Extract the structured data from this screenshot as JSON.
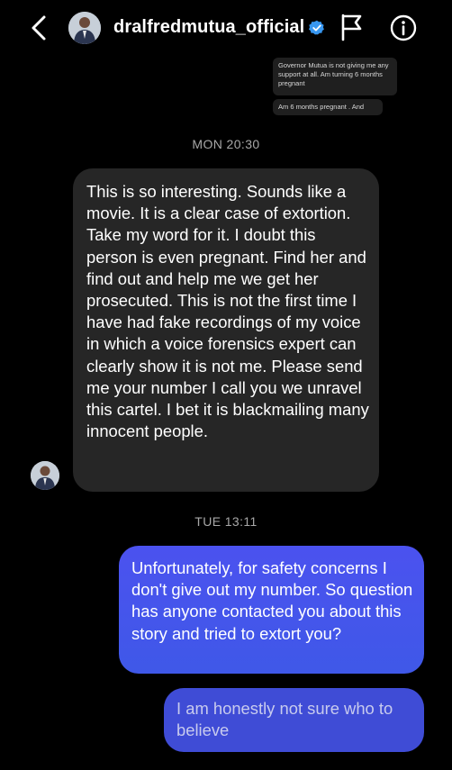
{
  "header": {
    "back_icon": "chevron-left-icon",
    "username": "dralfredmutua_official",
    "verified_icon": "verified-badge-icon",
    "report_icon": "flag-icon",
    "info_icon": "info-icon",
    "accent_color": "#3897f0"
  },
  "earlier_messages": [
    {
      "text": "Governor Mutua is not giving me any support at all. Am turning 6 months pregnant"
    },
    {
      "text": "Am 6 months pregnant . And"
    }
  ],
  "timestamps": [
    "MON 20:30",
    "TUE 13:11"
  ],
  "messages": [
    {
      "direction": "incoming",
      "text": "This is so interesting. Sounds like a movie. It is a clear case of extortion. Take my word for it. I doubt this person is even pregnant. Find her and find out and help me we get her prosecuted. This is not the first time I have had fake recordings of my voice in which a voice forensics expert can clearly show it is not me. Please send me your number I call you we unravel this cartel. I bet it is blackmailing many innocent people."
    },
    {
      "direction": "outgoing",
      "text": "Unfortunately, for safety concerns I don't give out my number. So question has anyone contacted you about this story and tried to extort you?"
    },
    {
      "direction": "outgoing",
      "text": "I am honestly not sure who to believe"
    }
  ],
  "colors": {
    "background": "#000000",
    "incoming_bubble": "#262626",
    "outgoing_bubble": "#4b52ef",
    "timestamp_text": "#a8a8a8"
  }
}
